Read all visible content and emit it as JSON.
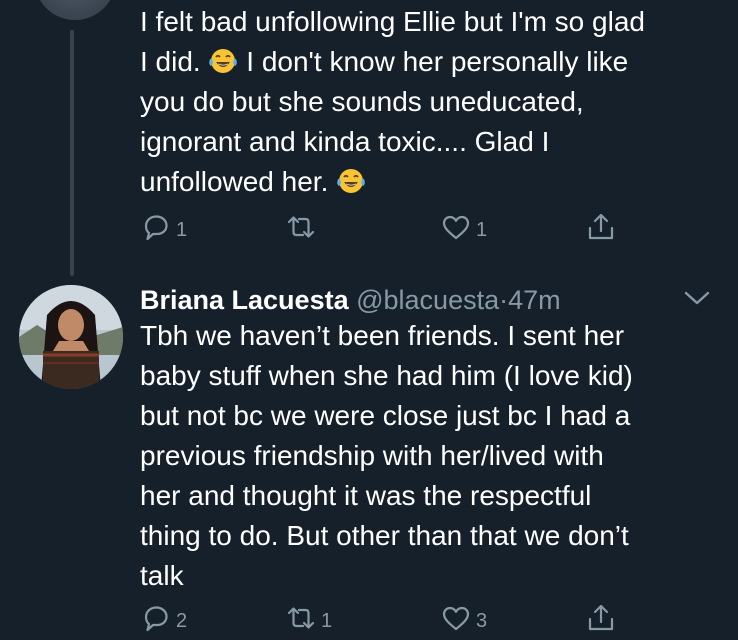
{
  "tweet1": {
    "text_a": "I felt bad unfollowing Ellie but I'm so glad\nI did. ",
    "text_b": " I don't know her personally like\nyou do but she sounds uneducated,\nignorant and kinda toxic.... Glad I\nunfollowed her. ",
    "emoji_icon": "face-with-tears-of-joy-icon",
    "reply_count": "1",
    "retweet_count": "",
    "like_count": "1"
  },
  "tweet2": {
    "name": "Briana Lacuesta",
    "handle": "@blacuesta",
    "separator": "·",
    "time": "47m",
    "text": "Tbh we haven’t been friends. I sent her\nbaby stuff when she had him (I love kid)\nbut not bc we were close just bc I had a\nprevious friendship with her/lived with\nher and thought it was the respectful\nthing to do. But other than that we don’t\ntalk",
    "reply_count": "2",
    "retweet_count": "1",
    "like_count": "3"
  },
  "colors": {
    "background": "#15202b",
    "text": "#ffffff",
    "muted": "#8899a6",
    "thread_line": "#38444d"
  }
}
